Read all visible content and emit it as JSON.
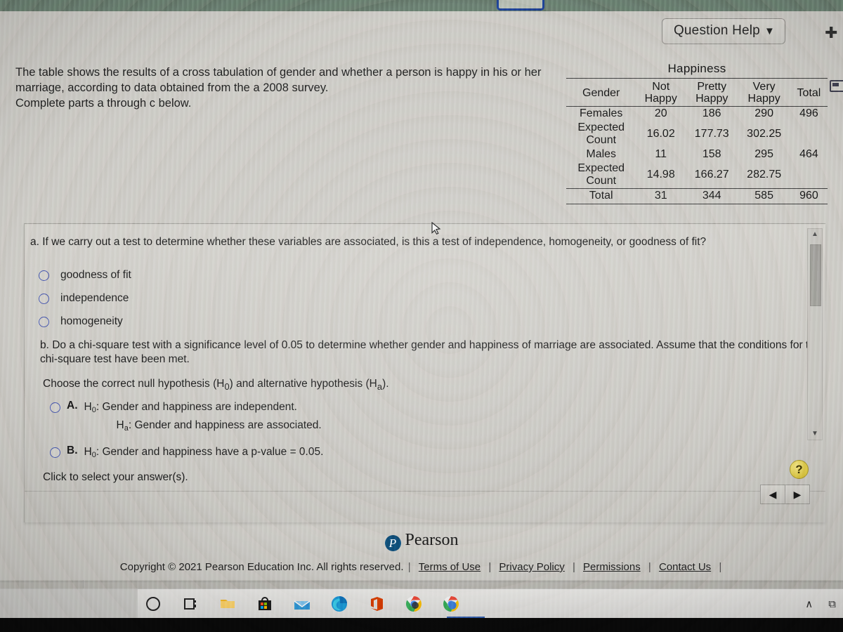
{
  "top_bar": {
    "question_help_label": "Question Help",
    "caret": "▼"
  },
  "stem": {
    "line1": "The table shows the results of a cross tabulation of gender and whether a person is happy in his or her",
    "line2": "marriage, according to data obtained from the a 2008 survey.",
    "line3": "Complete parts a through c below."
  },
  "table": {
    "title": "Happiness",
    "col_headers": [
      "Gender",
      "Not Happy",
      "Pretty Happy",
      "Very Happy",
      "Total"
    ],
    "col_headers_split": [
      {
        "top": "Gender",
        "bottom": ""
      },
      {
        "top": "Not",
        "bottom": "Happy"
      },
      {
        "top": "Pretty",
        "bottom": "Happy"
      },
      {
        "top": "Very",
        "bottom": "Happy"
      },
      {
        "top": "Total",
        "bottom": ""
      }
    ],
    "rows": [
      {
        "label": "Females",
        "label2": "",
        "cells": [
          "20",
          "186",
          "290",
          "496"
        ]
      },
      {
        "label": "Expected",
        "label2": "Count",
        "cells": [
          "16.02",
          "177.73",
          "302.25",
          ""
        ]
      },
      {
        "label": "Males",
        "label2": "",
        "cells": [
          "11",
          "158",
          "295",
          "464"
        ]
      },
      {
        "label": "Expected",
        "label2": "Count",
        "cells": [
          "14.98",
          "166.27",
          "282.75",
          ""
        ]
      }
    ],
    "total_row": {
      "label": "Total",
      "cells": [
        "31",
        "344",
        "585",
        "960"
      ]
    }
  },
  "part_a": {
    "prompt": "a. If we carry out a test to determine whether these variables are associated, is this a test of independence, homogeneity, or goodness of fit?",
    "choices": [
      {
        "label": "goodness of fit",
        "selected": false
      },
      {
        "label": "independence",
        "selected": false
      },
      {
        "label": "homogeneity",
        "selected": false
      }
    ]
  },
  "part_b": {
    "prompt_line1": "b. Do a chi-square test with a significance level of 0.05 to determine whether gender and happiness of marriage are associated. Assume that the conditions for the",
    "prompt_line2": "chi-square test have been met.",
    "hypothesis_instruction_pre": "Choose the correct null hypothesis (H",
    "hypothesis_instruction_mid": ") and alternative hypothesis (H",
    "hypothesis_instruction_post": ").",
    "sub_null": "0",
    "sub_alt": "a",
    "options": [
      {
        "key": "A.",
        "line1_pre": "H",
        "line1_sub": "0",
        "line1_post": ": Gender and happiness are independent.",
        "line2_pre": "H",
        "line2_sub": "a",
        "line2_post": ": Gender and happiness are associated.",
        "selected": false
      },
      {
        "key": "B.",
        "line1_pre": "H",
        "line1_sub": "0",
        "line1_post": ": Gender and happiness have a p-value = 0.05.",
        "line2_pre": "",
        "line2_sub": "",
        "line2_post": "",
        "selected": false
      }
    ],
    "click_hint": "Click to select your answer(s)."
  },
  "nav": {
    "help_badge": "?",
    "prev": "◀",
    "next": "▶"
  },
  "scrollbar": {
    "up_arrow": "▲",
    "down_arrow": "▼"
  },
  "footer": {
    "brand_mark": "P",
    "brand": "Pearson",
    "copyright": "Copyright © 2021 Pearson Education Inc. All rights reserved.",
    "links": [
      "Terms of Use",
      "Privacy Policy",
      "Permissions",
      "Contact Us"
    ],
    "separator": "|"
  },
  "taskbar": {
    "items": [
      {
        "name": "cortana-icon",
        "glyph": "◯"
      },
      {
        "name": "task-view-icon",
        "glyph": "⌸"
      },
      {
        "name": "file-explorer-icon",
        "glyph": ""
      },
      {
        "name": "microsoft-store-icon",
        "glyph": ""
      },
      {
        "name": "mail-icon",
        "glyph": ""
      },
      {
        "name": "edge-icon",
        "glyph": ""
      },
      {
        "name": "office-icon",
        "glyph": ""
      },
      {
        "name": "chrome-icon",
        "glyph": ""
      },
      {
        "name": "chrome-icon-2",
        "glyph": ""
      }
    ],
    "tray": [
      {
        "name": "show-hidden-icons-chevron",
        "glyph": "∧"
      },
      {
        "name": "tray-device-icon",
        "glyph": "⧉"
      }
    ]
  },
  "colors": {
    "accent_blue": "#3f4fa8",
    "pearson_blue": "#0f4a72",
    "help_yellow": "#d8c23c",
    "page_bg": "#c9c7c1"
  }
}
